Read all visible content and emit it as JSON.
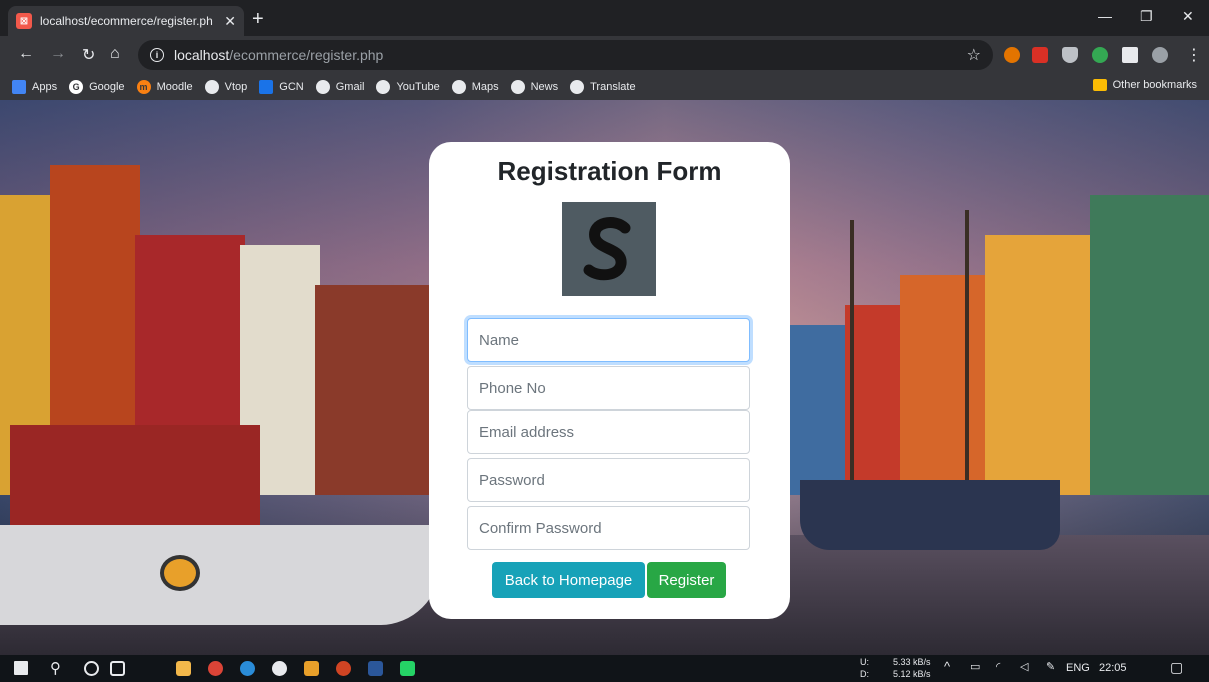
{
  "browser": {
    "tab_title": "localhost/ecommerce/register.ph",
    "tab_close": "✕",
    "new_tab": "+",
    "url_host": "localhost",
    "url_path": "/ecommerce/register.php",
    "window_controls": {
      "minimize": "—",
      "restore": "❐",
      "close": "✕"
    }
  },
  "bookmarks": [
    {
      "label": "Apps",
      "color": "#4285f4"
    },
    {
      "label": "Google",
      "color": "#ffffff"
    },
    {
      "label": "Moodle",
      "color": "#f98012"
    },
    {
      "label": "Vtop",
      "color": "#ffffff"
    },
    {
      "label": "GCN",
      "color": "#1a73e8"
    },
    {
      "label": "Gmail",
      "color": "#ffffff"
    },
    {
      "label": "YouTube",
      "color": "#ffffff"
    },
    {
      "label": "Maps",
      "color": "#ffffff"
    },
    {
      "label": "News",
      "color": "#ffffff"
    },
    {
      "label": "Translate",
      "color": "#ffffff"
    }
  ],
  "other_bookmarks": "Other bookmarks",
  "form": {
    "title": "Registration Form",
    "logo_letter": "S",
    "fields": [
      {
        "placeholder": "Name",
        "name": "name-field"
      },
      {
        "placeholder": "Phone No",
        "name": "phone-field"
      },
      {
        "placeholder": "Email address",
        "name": "email-field"
      },
      {
        "placeholder": "Password",
        "name": "password-field"
      },
      {
        "placeholder": "Confirm Password",
        "name": "confirm-password-field"
      }
    ],
    "back_label": "Back to Homepage",
    "register_label": "Register",
    "colors": {
      "back": "#17a2b8",
      "register": "#28a745"
    }
  },
  "taskbar": {
    "net_up_label": "U:",
    "net_down_label": "D:",
    "net_up": "5.33 kB/s",
    "net_down": "5.12 kB/s",
    "language": "ENG",
    "time": "22:05"
  }
}
